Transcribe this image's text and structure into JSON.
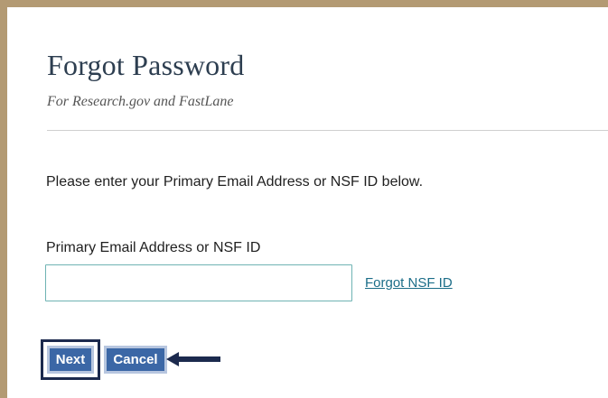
{
  "header": {
    "title": "Forgot Password",
    "subtitle": "For Research.gov and FastLane"
  },
  "form": {
    "instructions": "Please enter your Primary Email Address or NSF ID below.",
    "field_label": "Primary Email Address or NSF ID",
    "field_value": "",
    "field_placeholder": "",
    "forgot_link": "Forgot NSF ID"
  },
  "actions": {
    "next_label": "Next",
    "cancel_label": "Cancel"
  },
  "annotation": {
    "arrow_icon": "left-arrow-icon"
  },
  "colors": {
    "frame_border": "#b39a73",
    "button_bg": "#3b67a6",
    "link": "#1b6d88",
    "annotation": "#1c2a4e"
  }
}
